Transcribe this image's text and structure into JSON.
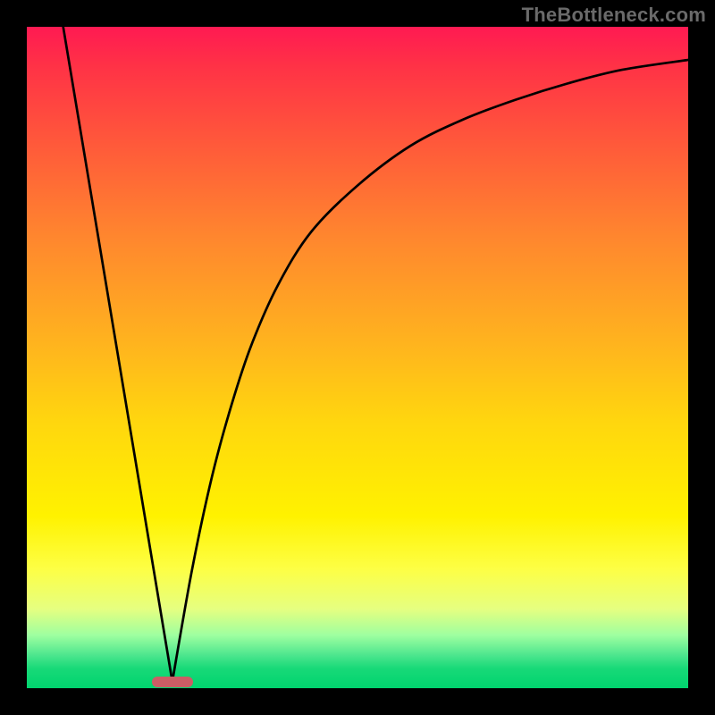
{
  "watermark": "TheBottleneck.com",
  "chart_data": {
    "type": "line",
    "title": "",
    "xlabel": "",
    "ylabel": "",
    "xlim": [
      0,
      100
    ],
    "ylim": [
      0,
      100
    ],
    "grid": false,
    "legend": false,
    "marker": {
      "x": 22,
      "y": 1
    },
    "series": [
      {
        "name": "left-branch",
        "x": [
          5.5,
          22
        ],
        "y": [
          100,
          1
        ]
      },
      {
        "name": "right-curve",
        "x": [
          22,
          25,
          28,
          31,
          34,
          38,
          43,
          50,
          58,
          66,
          74,
          82,
          90,
          100
        ],
        "y": [
          1,
          18,
          32,
          43,
          52,
          61,
          69,
          76,
          82,
          86,
          89,
          91.5,
          93.5,
          95
        ]
      }
    ],
    "gradient_stops": [
      {
        "pos": 0,
        "color": "#ff1a52"
      },
      {
        "pos": 6,
        "color": "#ff3246"
      },
      {
        "pos": 18,
        "color": "#ff5a3a"
      },
      {
        "pos": 32,
        "color": "#ff872e"
      },
      {
        "pos": 48,
        "color": "#ffb41e"
      },
      {
        "pos": 60,
        "color": "#ffd70e"
      },
      {
        "pos": 74,
        "color": "#fff200"
      },
      {
        "pos": 82,
        "color": "#fdff45"
      },
      {
        "pos": 88,
        "color": "#e6ff80"
      },
      {
        "pos": 92,
        "color": "#9effa0"
      },
      {
        "pos": 95,
        "color": "#4de68e"
      },
      {
        "pos": 97,
        "color": "#18d978"
      },
      {
        "pos": 100,
        "color": "#00d46e"
      }
    ]
  }
}
